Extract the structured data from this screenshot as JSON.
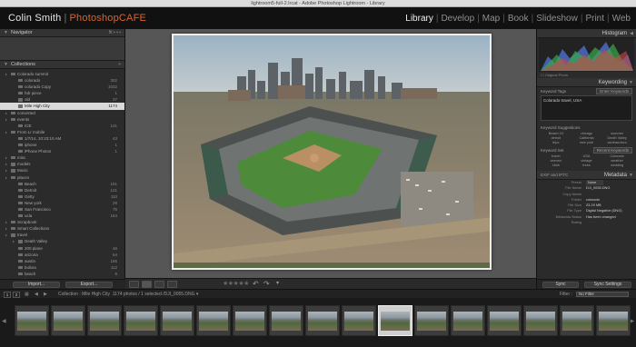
{
  "window": {
    "title": "lightroom5-full-2.lrcat - Adobe Photoshop Lightroom - Library"
  },
  "identity": {
    "name": "Colin Smith",
    "separator": "|",
    "brand": "PhotoshopCAFE"
  },
  "modules": [
    "Library",
    "Develop",
    "Map",
    "Book",
    "Slideshow",
    "Print",
    "Web"
  ],
  "active_module": "Library",
  "left_panel": {
    "navigator_label": "Navigator",
    "collections_label": "Collections",
    "collections": [
      {
        "name": "Colorado summit",
        "count": "",
        "indent": 2
      },
      {
        "name": "colorado",
        "count": "302",
        "indent": 3
      },
      {
        "name": "colorado Copy",
        "count": "1032",
        "indent": 3
      },
      {
        "name": "hdr piece",
        "count": "1",
        "indent": 3
      },
      {
        "name": "old",
        "count": "37",
        "indent": 3
      },
      {
        "name": "Mile High City",
        "count": "1174",
        "indent": 3,
        "selected": true
      },
      {
        "name": "converted",
        "count": "",
        "indent": 2
      },
      {
        "name": "events",
        "count": "",
        "indent": 2
      },
      {
        "name": "ICE",
        "count": "121",
        "indent": 3
      },
      {
        "name": "From Lr mobile",
        "count": "",
        "indent": 2
      },
      {
        "name": "1/7/14, 10:23:10 AM",
        "count": "43",
        "indent": 3
      },
      {
        "name": "iphone",
        "count": "1",
        "indent": 3
      },
      {
        "name": "iPhone Photos",
        "count": "1",
        "indent": 3
      },
      {
        "name": "misc",
        "count": "",
        "indent": 2
      },
      {
        "name": "models",
        "count": "",
        "indent": 2
      },
      {
        "name": "Music",
        "count": "",
        "indent": 2
      },
      {
        "name": "places",
        "count": "",
        "indent": 2
      },
      {
        "name": "Beach",
        "count": "151",
        "indent": 3
      },
      {
        "name": "Detroit",
        "count": "121",
        "indent": 3
      },
      {
        "name": "Getty",
        "count": "110",
        "indent": 3
      },
      {
        "name": "New york",
        "count": "29",
        "indent": 3
      },
      {
        "name": "San Francisco",
        "count": "75",
        "indent": 3
      },
      {
        "name": "ucla",
        "count": "184",
        "indent": 3
      },
      {
        "name": "Scrapbook",
        "count": "",
        "indent": 2
      },
      {
        "name": "Smart Collections",
        "count": "",
        "indent": 2
      },
      {
        "name": "travel",
        "count": "",
        "indent": 2
      },
      {
        "name": "Death Valley",
        "count": "",
        "indent": 3
      },
      {
        "name": "200 plane",
        "count": "46",
        "indent": 3
      },
      {
        "name": "arizona",
        "count": "64",
        "indent": 3
      },
      {
        "name": "austin",
        "count": "165",
        "indent": 3
      },
      {
        "name": "bolivia",
        "count": "112",
        "indent": 3
      },
      {
        "name": "beach",
        "count": "9",
        "indent": 3
      },
      {
        "name": "boston",
        "count": "216",
        "indent": 3
      },
      {
        "name": "catalina",
        "count": "",
        "indent": 3
      }
    ],
    "import_label": "Import...",
    "export_label": "Export..."
  },
  "right_panel": {
    "histogram_label": "Histogram",
    "original_photo": "Original Photo",
    "keywording_label": "Keywording",
    "keyword_tags_label": "Keyword Tags",
    "keyword_tags_value": "Enter Keywords",
    "keywords_text": "Colorado travel, USA",
    "keyword_suggestions_label": "Keyword Suggestions",
    "suggestions": [
      "Beach 24",
      "chicago",
      "summer",
      "detroit",
      "California",
      "Death Valley",
      "trips",
      "new york",
      "sanfrancisco"
    ],
    "keyword_set_label": "Keyword Set",
    "keyword_set_value": "Recent Keywords",
    "keyword_set": [
      "travel",
      "USA",
      "Colorado",
      "women",
      "vintage",
      "weather",
      "Utah",
      "trees",
      "wedding"
    ],
    "metadata_label": "Metadata",
    "metadata_preset": "EXIF and IPTC",
    "preset_label": "Preset",
    "preset_value": "None",
    "meta": [
      {
        "k": "File Name",
        "v": "DJI_0055.DNG"
      },
      {
        "k": "Copy Name",
        "v": ""
      },
      {
        "k": "Folder",
        "v": "colorado"
      },
      {
        "k": "File Size",
        "v": "23.29 MB"
      },
      {
        "k": "File Type",
        "v": "Digital Negative (DNG)"
      },
      {
        "k": "Metadata Status",
        "v": "Has been changed"
      }
    ],
    "rating_label": "Rating",
    "sync_label": "Sync",
    "sync_settings_label": "Sync Settings"
  },
  "filmstrip": {
    "source": "Collection : Mile High City",
    "summary": "1174 photos / 1 selected /DJI_0055.DNG",
    "filter_label": "Filter :",
    "filter_value": "No Filter",
    "screen1": "1",
    "screen2": "2",
    "thumb_count": 17,
    "selected_index": 10
  },
  "colors": {
    "accent_brand": "#e0632a",
    "selection": "#dadada",
    "panel_bg": "#2b2b2b"
  }
}
